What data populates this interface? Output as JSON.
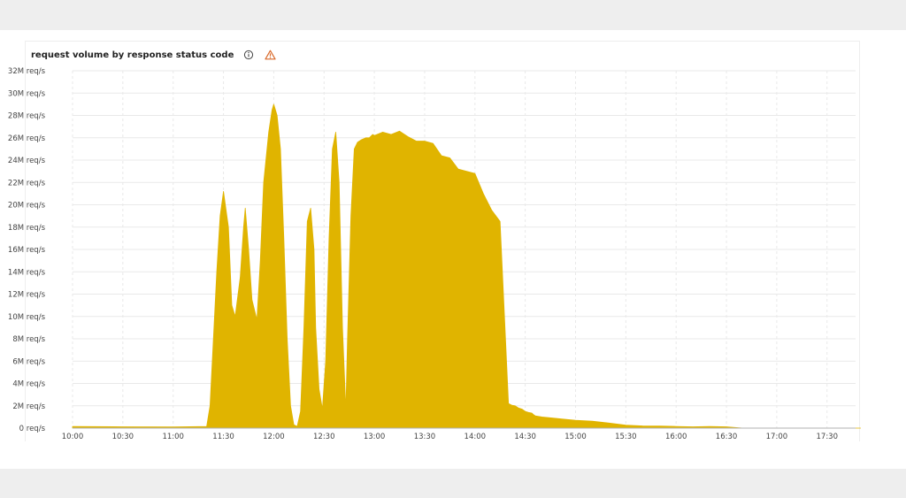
{
  "panel": {
    "title": "request volume by response status code",
    "info_icon": "info-icon",
    "warning_icon": "warning-icon"
  },
  "colors": {
    "series": "#e0b400",
    "warning": "#d96a2b",
    "grid": "#e9e9e9",
    "axis": "#b0b0b0"
  },
  "chart_data": {
    "type": "area",
    "title": "request volume by response status code",
    "xlabel": "",
    "ylabel": "",
    "grid": true,
    "xlim": [
      "10:00",
      "17:50"
    ],
    "ylim": [
      0,
      32000000
    ],
    "x_ticks": [
      "10:00",
      "10:30",
      "11:00",
      "11:30",
      "12:00",
      "12:30",
      "13:00",
      "13:30",
      "14:00",
      "14:30",
      "15:00",
      "15:30",
      "16:00",
      "16:30",
      "17:00",
      "17:30"
    ],
    "y_ticks": [
      "0 req/s",
      "2M req/s",
      "4M req/s",
      "6M req/s",
      "8M req/s",
      "10M req/s",
      "12M req/s",
      "14M req/s",
      "16M req/s",
      "18M req/s",
      "20M req/s",
      "22M req/s",
      "24M req/s",
      "26M req/s",
      "28M req/s",
      "30M req/s",
      "32M req/s"
    ],
    "series": [
      {
        "color": "#e0b400",
        "x": [
          "10:00",
          "10:30",
          "11:00",
          "11:20",
          "11:22",
          "11:24",
          "11:26",
          "11:28",
          "11:30",
          "11:33",
          "11:35",
          "11:37",
          "11:40",
          "11:42",
          "11:43",
          "11:45",
          "11:47",
          "11:50",
          "11:52",
          "11:54",
          "11:57",
          "11:59",
          "12:00",
          "12:02",
          "12:04",
          "12:06",
          "12:08",
          "12:10",
          "12:12",
          "12:14",
          "12:16",
          "12:18",
          "12:20",
          "12:22",
          "12:24",
          "12:25",
          "12:27",
          "12:29",
          "12:31",
          "12:33",
          "12:35",
          "12:37",
          "12:39",
          "12:41",
          "12:43",
          "12:44",
          "12:46",
          "12:48",
          "12:50",
          "12:52",
          "12:55",
          "12:57",
          "12:59",
          "13:00",
          "13:05",
          "13:10",
          "13:15",
          "13:20",
          "13:25",
          "13:30",
          "13:35",
          "13:40",
          "13:45",
          "13:50",
          "13:55",
          "14:00",
          "14:05",
          "14:10",
          "14:15",
          "14:20",
          "14:22",
          "14:24",
          "14:26",
          "14:28",
          "14:30",
          "14:32",
          "14:34",
          "14:35",
          "14:36",
          "14:40",
          "14:50",
          "15:00",
          "15:10",
          "15:20",
          "15:30",
          "15:40",
          "15:50",
          "16:00",
          "16:10",
          "16:20",
          "16:30",
          "16:40",
          "16:50",
          "16:56",
          "17:00",
          "17:05",
          "17:10",
          "17:20",
          "17:30",
          "17:40",
          "17:50"
        ],
        "values": [
          150000,
          120000,
          100000,
          150000,
          2000000,
          8000000,
          14000000,
          19000000,
          21200000,
          18000000,
          11000000,
          10000000,
          13500000,
          18000000,
          19700000,
          16000000,
          11500000,
          9700000,
          15000000,
          22000000,
          26500000,
          28500000,
          29000000,
          28000000,
          25000000,
          17000000,
          8000000,
          2000000,
          300000,
          150000,
          1500000,
          9000000,
          18500000,
          19700000,
          16000000,
          9000000,
          3500000,
          1700000,
          6000000,
          17000000,
          25000000,
          26500000,
          22000000,
          9000000,
          1600000,
          8000000,
          19000000,
          25000000,
          25600000,
          25800000,
          26000000,
          26000000,
          26300000,
          26200000,
          26500000,
          26300000,
          26600000,
          26100000,
          25700000,
          25700000,
          25500000,
          24400000,
          24200000,
          23200000,
          23000000,
          22800000,
          21000000,
          19500000,
          18500000,
          2200000,
          2050000,
          2000000,
          1800000,
          1700000,
          1500000,
          1400000,
          1350000,
          1200000,
          1100000,
          1000000,
          850000,
          700000,
          620000,
          450000,
          260000,
          200000,
          180000,
          150000,
          120000,
          150000,
          120000,
          1000,
          1000,
          1000,
          1000,
          1000,
          1000,
          1000,
          1000,
          1000,
          1000
        ]
      }
    ]
  }
}
